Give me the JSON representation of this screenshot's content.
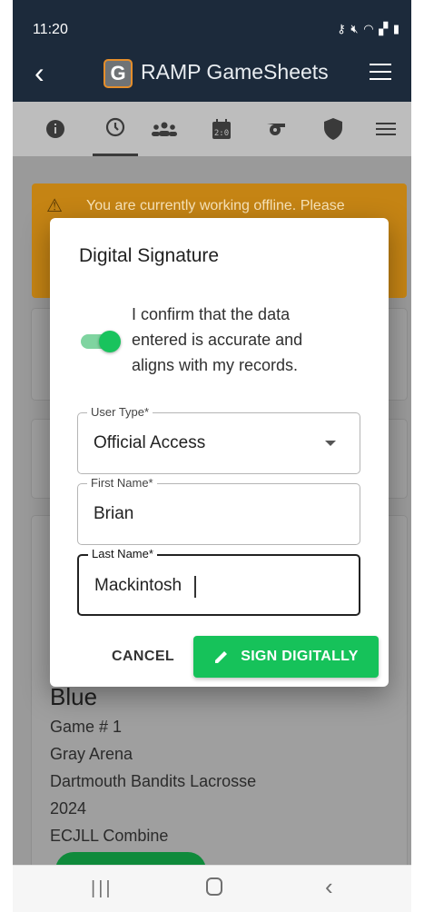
{
  "status_bar": {
    "time": "11:20",
    "icons": [
      "key-icon",
      "mute-icon",
      "wifi-icon",
      "signal-icon",
      "battery-icon"
    ]
  },
  "app_bar": {
    "logo_letter": "G",
    "title": "RAMP GameSheets"
  },
  "tabs": [
    {
      "icon": "info-icon"
    },
    {
      "icon": "clock-icon",
      "active": true
    },
    {
      "icon": "people-icon"
    },
    {
      "icon": "scoreboard-icon"
    },
    {
      "icon": "whistle-icon"
    },
    {
      "icon": "shield-icon"
    },
    {
      "icon": "menu-icon"
    }
  ],
  "background": {
    "offline_banner": "You are currently working offline. Please",
    "team": "Blue",
    "game_number": "Game # 1",
    "arena": "Gray Arena",
    "organization": "Dartmouth Bandits Lacrosse",
    "year": "2024",
    "event": "ECJLL Combine"
  },
  "dialog": {
    "title": "Digital Signature",
    "confirm_text": "I confirm that the data entered is accurate and aligns with my records.",
    "confirm_checked": true,
    "user_type_label": "User Type*",
    "user_type_value": "Official Access",
    "first_name_label": "First Name*",
    "first_name_value": "Brian",
    "last_name_label": "Last Name*",
    "last_name_value": "Mackintosh",
    "cancel_label": "CANCEL",
    "sign_label": "SIGN DIGITALLY"
  },
  "colors": {
    "header": "#1c2a3b",
    "accent_green": "#16c25a",
    "banner": "#c58414"
  }
}
